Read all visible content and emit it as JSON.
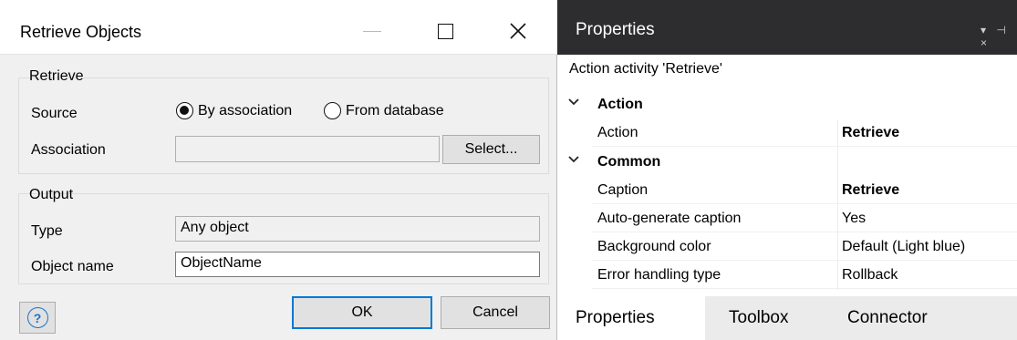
{
  "dialog": {
    "title": "Retrieve Objects",
    "retrieve_group": {
      "legend": "Retrieve",
      "source_label": "Source",
      "source_options": [
        "By association",
        "From database"
      ],
      "source_selected": "By association",
      "association_label": "Association",
      "association_value": "",
      "select_button": "Select..."
    },
    "output_group": {
      "legend": "Output",
      "type_label": "Type",
      "type_value": "Any object",
      "object_name_label": "Object name",
      "object_name_value": "ObjectName"
    },
    "ok_button": "OK",
    "cancel_button": "Cancel",
    "help_symbol": "?"
  },
  "properties": {
    "title": "Properties",
    "header_icons": "▾ ⊣ ×",
    "subtitle": "Action activity 'Retrieve'",
    "sections": [
      {
        "name": "Action",
        "rows": [
          {
            "key": "Action",
            "value": "Retrieve",
            "bold": true
          }
        ]
      },
      {
        "name": "Common",
        "rows": [
          {
            "key": "Caption",
            "value": "Retrieve",
            "bold": true
          },
          {
            "key": "Auto-generate caption",
            "value": "Yes",
            "bold": false
          },
          {
            "key": "Background color",
            "value": "Default (Light blue)",
            "bold": false
          },
          {
            "key": "Error handling type",
            "value": "Rollback",
            "bold": false
          }
        ]
      }
    ],
    "tabs": [
      "Properties",
      "Toolbox",
      "Connector"
    ],
    "active_tab": "Properties"
  },
  "colors": {
    "properties_header_bg": "#2d2d30",
    "ok_focus_border": "#0078d7",
    "help_icon": "#1a73c8"
  }
}
